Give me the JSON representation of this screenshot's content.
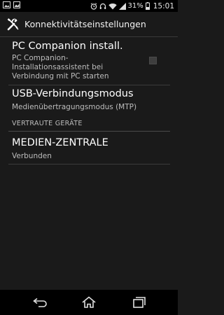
{
  "status_bar": {
    "battery_percent": "31%",
    "time": "15:01",
    "icons": [
      "photo-icon",
      "image-icon",
      "alarm-icon",
      "headset-icon",
      "wifi-icon",
      "signal-icon",
      "battery-icon"
    ]
  },
  "action_bar": {
    "title": "Konnektivitätseinstellungen",
    "icon": "wrench-screwdriver-icon"
  },
  "items": [
    {
      "title": "PC Companion install.",
      "subtitle_lines": [
        "PC Companion-",
        "Installationsassistent bei",
        "Verbindung mit PC starten"
      ],
      "checked": false
    },
    {
      "title": "USB-Verbindungsmodus",
      "subtitle": "Medienübertragungsmodus (MTP)"
    }
  ],
  "section": {
    "header": "VERTRAUTE GERÄTE",
    "items": [
      {
        "title": "MEDIEN-ZENTRALE",
        "subtitle": "Verbunden"
      }
    ]
  },
  "nav_bar": {
    "icons": [
      "back-icon",
      "home-icon",
      "recent-apps-icon"
    ]
  },
  "colors": {
    "background": "#1a1a1a",
    "status_bar": "#000000",
    "divider": "#3b3b3b",
    "primary_text": "#ffffff",
    "secondary_text": "#bdbdbd"
  }
}
